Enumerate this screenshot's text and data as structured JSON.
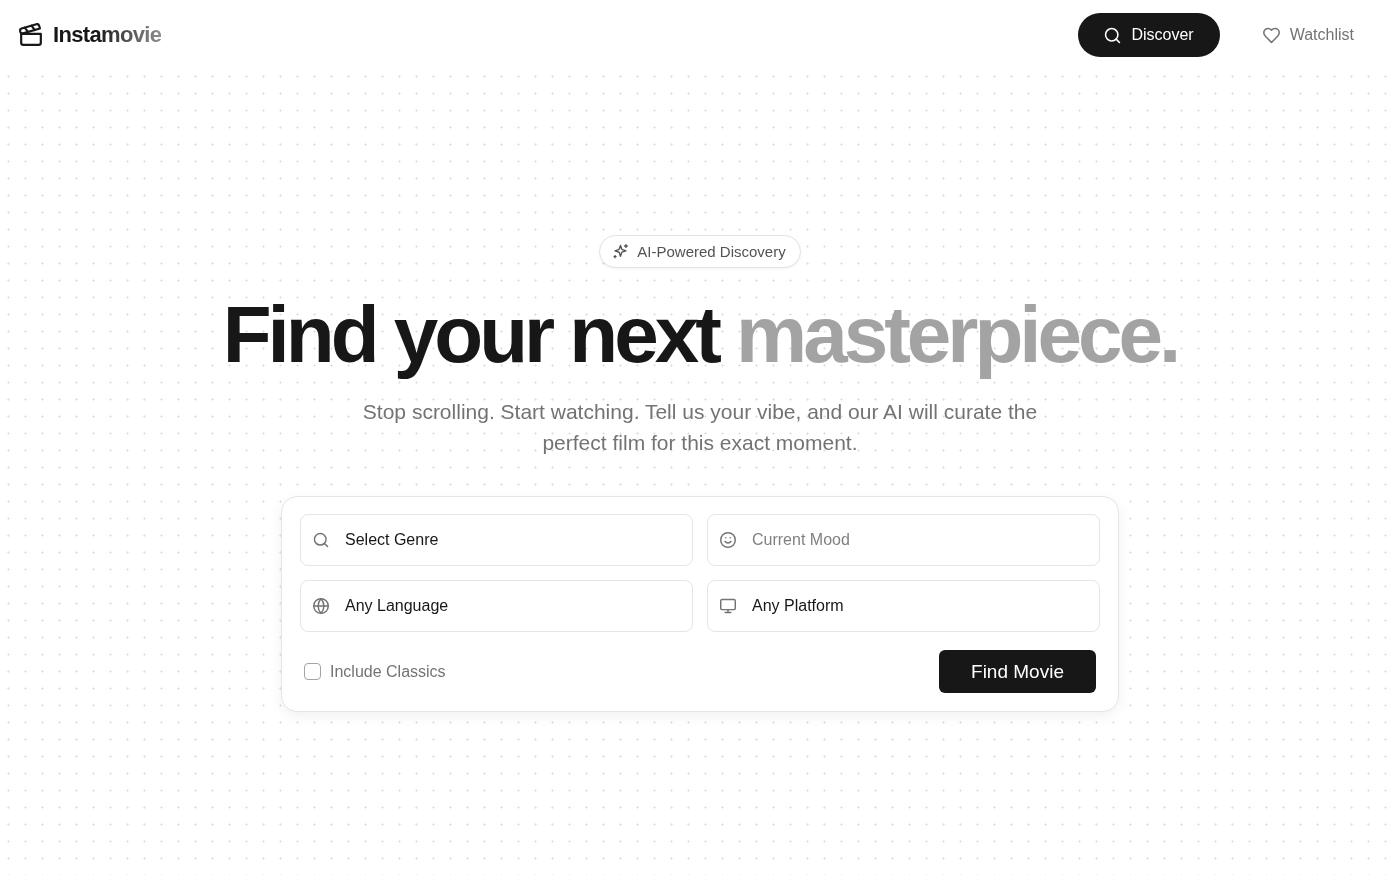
{
  "header": {
    "logo": "Instamovie",
    "nav": [
      {
        "label": "Discover",
        "selected": true
      },
      {
        "label": "Watchlist",
        "selected": false
      }
    ]
  },
  "hero": {
    "badge": "AI-Powered Discovery",
    "headline": {
      "text": "Find your next",
      "highlight": "masterpiece."
    },
    "subtitle": "Stop scrolling. Start watching. Tell us your vibe, and our AI will curate the perfect film for this exact moment."
  },
  "search_form": {
    "fields": [
      {
        "kind": "genre",
        "value": "Select Genre"
      },
      {
        "kind": "mood",
        "placeholder": "Current Mood"
      },
      {
        "kind": "language",
        "value": "Any Language"
      },
      {
        "kind": "platform",
        "value": "Any Platform"
      }
    ],
    "include_classics": {
      "label": "Include Classics",
      "checked": false
    },
    "submit": "Find Movie"
  }
}
